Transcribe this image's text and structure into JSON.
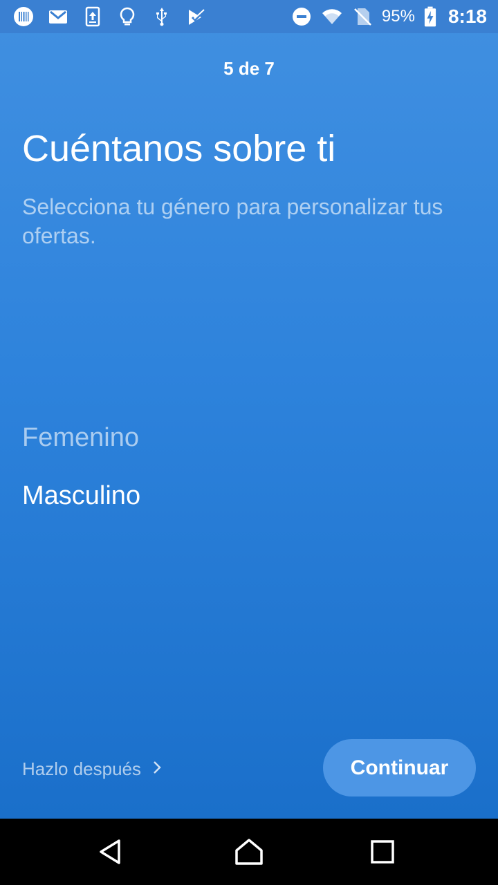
{
  "statusbar": {
    "icons_left": [
      "barcode-icon",
      "gmail-icon",
      "upload-icon",
      "lightbulb-icon",
      "usb-icon",
      "checkmark-app-icon"
    ],
    "icons_right": [
      "do-not-disturb-icon",
      "wifi-icon",
      "no-sim-icon",
      "battery-charging-icon"
    ],
    "battery": "95%",
    "time": "8:18"
  },
  "onboarding": {
    "step": "5 de 7",
    "title": "Cuéntanos sobre ti",
    "subtitle": "Selecciona tu género para personalizar tus ofertas.",
    "options": [
      "Femenino",
      "Masculino"
    ],
    "selected": "Masculino",
    "skip_label": "Hazlo después",
    "continue_label": "Continuar"
  },
  "colors": {
    "background_top": "#4190e1",
    "background_bottom": "#1a6fca",
    "button": "#4d96e5"
  },
  "navbar": {
    "icons": [
      "back-icon",
      "home-icon",
      "recents-icon"
    ]
  }
}
